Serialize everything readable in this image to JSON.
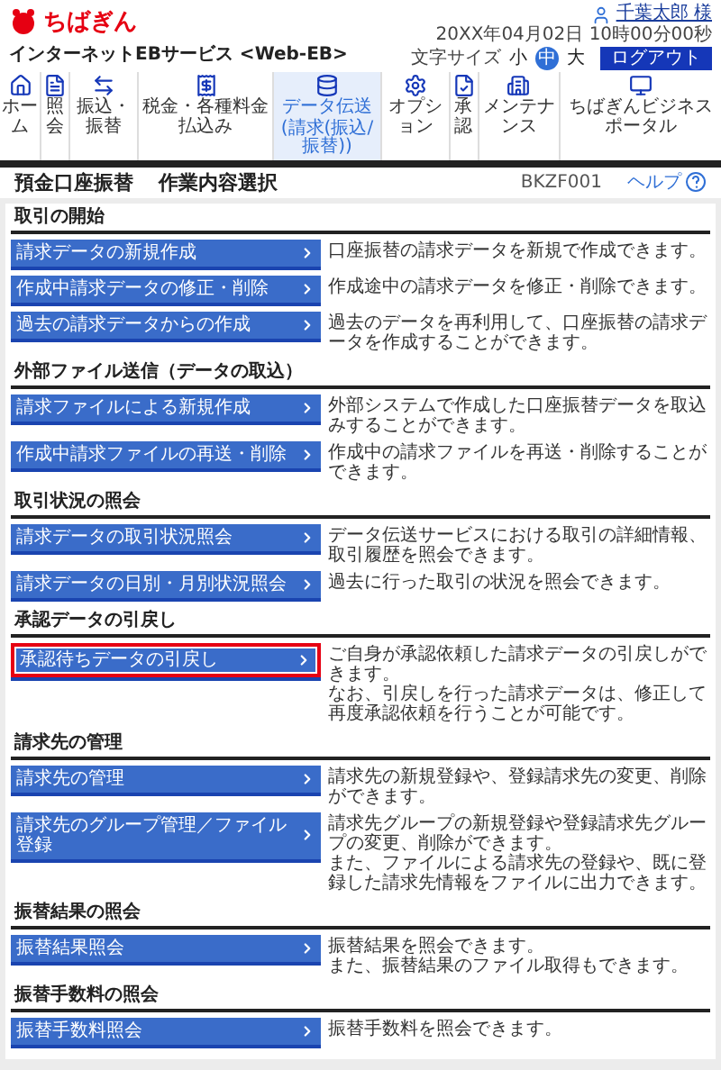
{
  "header": {
    "logo": "ちばぎん",
    "service": "インターネットEBサービス <Web-EB>",
    "user": "千葉太郎 様",
    "datetime": "20XX年04月02日 10時00分00秒",
    "font_size": {
      "label": "文字サイズ",
      "options": [
        {
          "label": "小",
          "selected": false
        },
        {
          "label": "中",
          "selected": true
        },
        {
          "label": "大",
          "selected": false
        }
      ]
    },
    "logout": "ログアウト"
  },
  "nav": [
    {
      "label": "ホーム",
      "selected": false
    },
    {
      "label": "照会",
      "selected": false
    },
    {
      "label": "振込・振替",
      "selected": false
    },
    {
      "label": "税金・各種料金払込み",
      "selected": false
    },
    {
      "label": "データ伝送",
      "sublabel": "(請求(振込/振替))",
      "selected": true
    },
    {
      "label": "オプション",
      "selected": false
    },
    {
      "label": "承認",
      "selected": false
    },
    {
      "label": "メンテナンス",
      "selected": false
    },
    {
      "label": "ちばぎんビジネスポータル",
      "selected": false
    }
  ],
  "page": {
    "category": "預金口座振替",
    "title": "作業内容選択",
    "screen_id": "BKZF001",
    "help": "ヘルプ"
  },
  "sections": [
    {
      "title": "取引の開始",
      "items": [
        {
          "label": "請求データの新規作成",
          "description": [
            "口座振替の請求データを新規で作成できます。"
          ],
          "highlighted": false
        },
        {
          "label": "作成中請求データの修正・削除",
          "description": [
            "作成途中の請求データを修正・削除できます。"
          ],
          "highlighted": false
        },
        {
          "label": "過去の請求データからの作成",
          "description": [
            "過去のデータを再利用して、口座振替の請求データを作成することができます。"
          ],
          "highlighted": false
        }
      ]
    },
    {
      "title": "外部ファイル送信（データの取込）",
      "items": [
        {
          "label": "請求ファイルによる新規作成",
          "description": [
            "外部システムで作成した口座振替データを取込みすることができます。"
          ],
          "highlighted": false
        },
        {
          "label": "作成中請求ファイルの再送・削除",
          "description": [
            "作成中の請求ファイルを再送・削除することができます。"
          ],
          "highlighted": false
        }
      ]
    },
    {
      "title": "取引状況の照会",
      "items": [
        {
          "label": "請求データの取引状況照会",
          "description": [
            "データ伝送サービスにおける取引の詳細情報、取引履歴を照会できます。"
          ],
          "highlighted": false
        },
        {
          "label": "請求データの日別・月別状況照会",
          "description": [
            "過去に行った取引の状況を照会できます。"
          ],
          "highlighted": false
        }
      ]
    },
    {
      "title": "承認データの引戻し",
      "items": [
        {
          "label": "承認待ちデータの引戻し",
          "description": [
            "ご自身が承認依頼した請求データの引戻しができます。",
            "なお、引戻しを行った請求データは、修正して再度承認依頼を行うことが可能です。"
          ],
          "highlighted": true
        }
      ]
    },
    {
      "title": "請求先の管理",
      "items": [
        {
          "label": "請求先の管理",
          "description": [
            "請求先の新規登録や、登録請求先の変更、削除ができます。"
          ],
          "highlighted": false
        },
        {
          "label": "請求先のグループ管理／ファイル登録",
          "description": [
            "請求先グループの新規登録や登録請求先グループの変更、削除ができます。",
            "また、ファイルによる請求先の登録や、既に登録した請求先情報をファイルに出力できます。"
          ],
          "highlighted": false
        }
      ]
    },
    {
      "title": "振替結果の照会",
      "items": [
        {
          "label": "振替結果照会",
          "description": [
            "振替結果を照会できます。",
            "また、振替結果のファイル取得もできます。"
          ],
          "highlighted": false
        }
      ]
    },
    {
      "title": "振替手数料の照会",
      "items": [
        {
          "label": "振替手数料照会",
          "description": [
            "振替手数料を照会できます。"
          ],
          "highlighted": false
        }
      ]
    }
  ]
}
